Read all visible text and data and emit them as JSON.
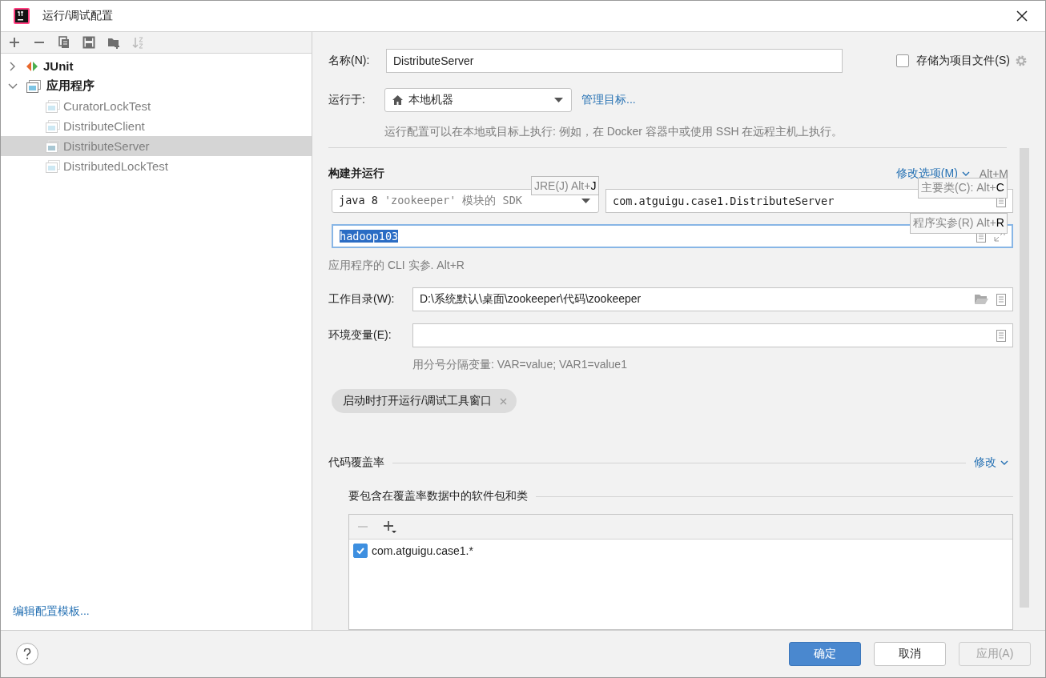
{
  "window": {
    "title": "运行/调试配置"
  },
  "toolbar": [
    {
      "kind": "add",
      "disabled": false
    },
    {
      "kind": "remove",
      "disabled": false
    },
    {
      "kind": "copy",
      "disabled": false
    },
    {
      "kind": "save",
      "disabled": false
    },
    {
      "kind": "folder",
      "disabled": false
    },
    {
      "kind": "sort",
      "disabled": true
    }
  ],
  "tree": [
    {
      "label": "JUnit",
      "kind": "junit",
      "expanded": false
    },
    {
      "label": "应用程序",
      "kind": "application",
      "expanded": true,
      "children": [
        {
          "label": "CuratorLockTest",
          "selected": false
        },
        {
          "label": "DistributeClient",
          "selected": false
        },
        {
          "label": "DistributeServer",
          "selected": true
        },
        {
          "label": "DistributedLockTest",
          "selected": false
        }
      ]
    }
  ],
  "edit_templates_link": "编辑配置模板...",
  "form": {
    "name_label": "名称(N):",
    "name_value": "DistributeServer",
    "store_label": "存储为项目文件(S)",
    "store_checked": false,
    "run_on_label": "运行于:",
    "run_on_value": "本地机器",
    "manage_targets": "管理目标...",
    "run_on_hint": "运行配置可以在本地或目标上执行: 例如，在 Docker 容器中或使用 SSH 在远程主机上执行。",
    "build_title": "构建并运行",
    "modify_options": "修改选项(M)",
    "modify_shortcut": "Alt+M",
    "jre_value": "java 8",
    "jre_detail": "'zookeeper' 模块的 SDK",
    "main_class": "com.atguigu.case1.DistributeServer",
    "program_args": "hadoop103",
    "program_args_selected": true,
    "args_hint": "应用程序的 CLI 实参. Alt+R",
    "workdir_label": "工作目录(W):",
    "workdir_value": "D:\\系统默认\\桌面\\zookeeper\\代码\\zookeeper",
    "env_label": "环境变量(E):",
    "env_hint": "用分号分隔变量: VAR=value; VAR1=value1",
    "chip": "启动时打开运行/调试工具窗口"
  },
  "tooltips": [
    {
      "text": "JRE(J) Alt+",
      "key": "J"
    },
    {
      "text": "主要类(C): Alt+",
      "key": "C"
    },
    {
      "text": "程序实参(R) Alt+",
      "key": "R"
    }
  ],
  "coverage": {
    "title": "代码覆盖率",
    "modify": "修改",
    "subtitle": "要包含在覆盖率数据中的软件包和类",
    "items": [
      {
        "label": "com.atguigu.case1.*",
        "checked": true
      }
    ]
  },
  "footer": {
    "buttons": [
      {
        "label": "确定",
        "kind": "primary",
        "disabled": false
      },
      {
        "label": "取消",
        "kind": "default",
        "disabled": false
      },
      {
        "label": "应用(A)",
        "kind": "default",
        "disabled": true
      }
    ]
  }
}
